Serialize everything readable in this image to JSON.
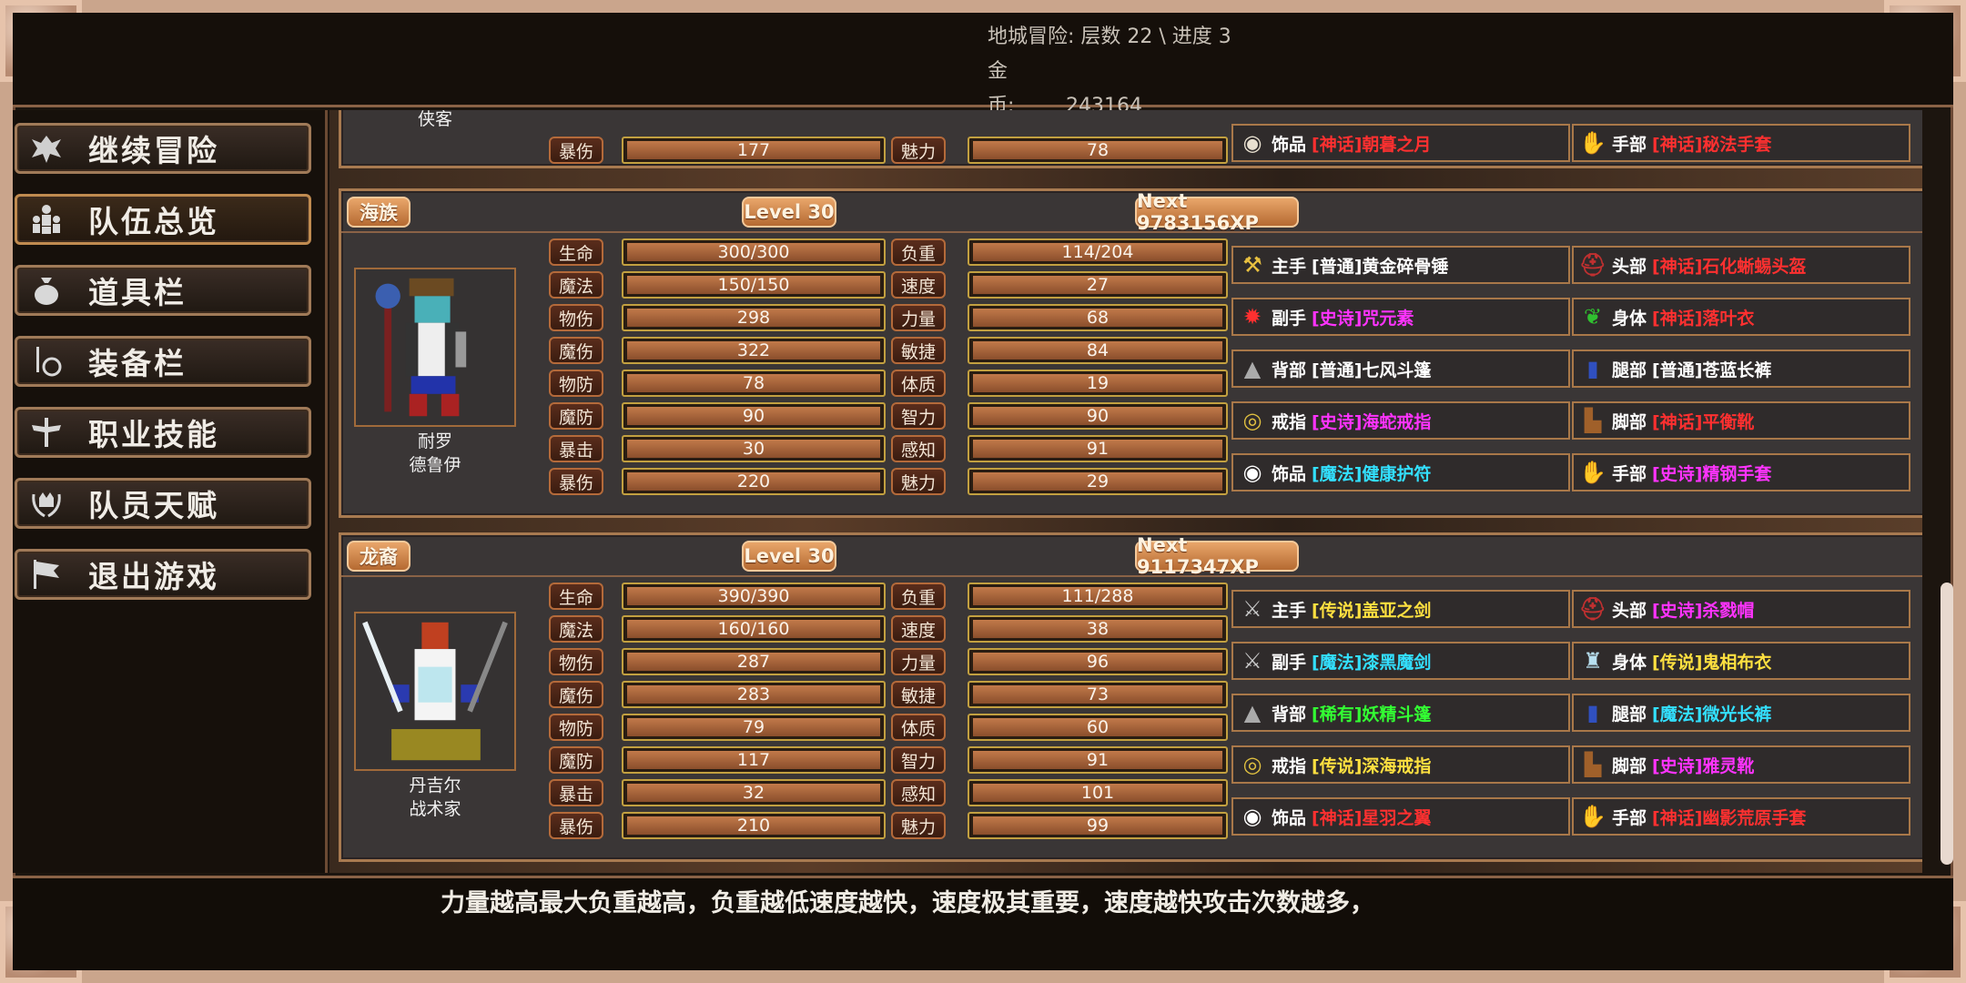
{
  "hud": {
    "dungeon_label": "地城冒险:",
    "dungeon_value": "层数 22 \\ 进度 3",
    "gold_label": "金　　币:",
    "gold_value": "243164"
  },
  "sidebar": {
    "items": [
      {
        "label": "继续冒险",
        "icon": "dragon-icon"
      },
      {
        "label": "队伍总览",
        "icon": "party-icon"
      },
      {
        "label": "道具栏",
        "icon": "bag-icon"
      },
      {
        "label": "装备栏",
        "icon": "sword-shield-icon"
      },
      {
        "label": "职业技能",
        "icon": "winged-sword-icon"
      },
      {
        "label": "队员天赋",
        "icon": "laurel-crown-icon"
      },
      {
        "label": "退出游戏",
        "icon": "flag-icon"
      }
    ]
  },
  "colors": {
    "普通": "#ffffff",
    "魔法": "#33e0ff",
    "稀有": "#33ff33",
    "史诗": "#ff33ff",
    "传说": "#ffe040",
    "神话": "#ff3030"
  },
  "top_partial": {
    "name_line": "侠客",
    "stats": [
      {
        "label": "暴伤",
        "value": "177"
      },
      {
        "label": "魅力",
        "value": "78"
      }
    ],
    "equipment": [
      {
        "slot": "饰品",
        "rarity": "神话",
        "name": "朝暮之月",
        "icon": "ring-amulet-icon"
      },
      {
        "slot": "手部",
        "rarity": "神话",
        "name": "秘法手套",
        "icon": "gauntlet-icon"
      }
    ]
  },
  "members": [
    {
      "race": "海族",
      "level": "Level 30",
      "next": "Next 9783156XP",
      "name_line1": "耐罗",
      "name_line2": "德鲁伊",
      "left_stats": [
        {
          "label": "生命",
          "value": "300/300"
        },
        {
          "label": "魔法",
          "value": "150/150"
        },
        {
          "label": "物伤",
          "value": "298"
        },
        {
          "label": "魔伤",
          "value": "322"
        },
        {
          "label": "物防",
          "value": "78"
        },
        {
          "label": "魔防",
          "value": "90"
        },
        {
          "label": "暴击",
          "value": "30"
        },
        {
          "label": "暴伤",
          "value": "220"
        }
      ],
      "right_stats": [
        {
          "label": "负重",
          "value": "114/204"
        },
        {
          "label": "速度",
          "value": "27"
        },
        {
          "label": "力量",
          "value": "68"
        },
        {
          "label": "敏捷",
          "value": "84"
        },
        {
          "label": "体质",
          "value": "19"
        },
        {
          "label": "智力",
          "value": "90"
        },
        {
          "label": "感知",
          "value": "91"
        },
        {
          "label": "魅力",
          "value": "29"
        }
      ],
      "equipment": [
        {
          "slot": "主手",
          "rarity": "普通",
          "name": "黄金碎骨锤",
          "icon": "mace-icon"
        },
        {
          "slot": "头部",
          "rarity": "神话",
          "name": "石化蜥蜴头盔",
          "icon": "helmet-icon"
        },
        {
          "slot": "副手",
          "rarity": "史诗",
          "name": "咒元素",
          "icon": "spirit-icon"
        },
        {
          "slot": "身体",
          "rarity": "神话",
          "name": "落叶衣",
          "icon": "leaf-armor-icon"
        },
        {
          "slot": "背部",
          "rarity": "普通",
          "name": "七风斗篷",
          "icon": "cloak-icon"
        },
        {
          "slot": "腿部",
          "rarity": "普通",
          "name": "苍蓝长裤",
          "icon": "pants-icon"
        },
        {
          "slot": "戒指",
          "rarity": "史诗",
          "name": "海蛇戒指",
          "icon": "ring-icon"
        },
        {
          "slot": "脚部",
          "rarity": "神话",
          "name": "平衡靴",
          "icon": "boots-icon"
        },
        {
          "slot": "饰品",
          "rarity": "魔法",
          "name": "健康护符",
          "icon": "amulet-icon"
        },
        {
          "slot": "手部",
          "rarity": "史诗",
          "name": "精钢手套",
          "icon": "gauntlet-icon"
        }
      ]
    },
    {
      "race": "龙裔",
      "level": "Level 30",
      "next": "Next 9117347XP",
      "name_line1": "丹吉尔",
      "name_line2": "战术家",
      "left_stats": [
        {
          "label": "生命",
          "value": "390/390"
        },
        {
          "label": "魔法",
          "value": "160/160"
        },
        {
          "label": "物伤",
          "value": "287"
        },
        {
          "label": "魔伤",
          "value": "283"
        },
        {
          "label": "物防",
          "value": "79"
        },
        {
          "label": "魔防",
          "value": "117"
        },
        {
          "label": "暴击",
          "value": "32"
        },
        {
          "label": "暴伤",
          "value": "210"
        }
      ],
      "right_stats": [
        {
          "label": "负重",
          "value": "111/288"
        },
        {
          "label": "速度",
          "value": "38"
        },
        {
          "label": "力量",
          "value": "96"
        },
        {
          "label": "敏捷",
          "value": "73"
        },
        {
          "label": "体质",
          "value": "60"
        },
        {
          "label": "智力",
          "value": "91"
        },
        {
          "label": "感知",
          "value": "101"
        },
        {
          "label": "魅力",
          "value": "99"
        }
      ],
      "equipment": [
        {
          "slot": "主手",
          "rarity": "传说",
          "name": "盖亚之剑",
          "icon": "sword-icon"
        },
        {
          "slot": "头部",
          "rarity": "史诗",
          "name": "杀戮帽",
          "icon": "helmet-icon"
        },
        {
          "slot": "副手",
          "rarity": "魔法",
          "name": "漆黑魔剑",
          "icon": "sword-icon"
        },
        {
          "slot": "身体",
          "rarity": "传说",
          "name": "鬼相布衣",
          "icon": "robe-icon"
        },
        {
          "slot": "背部",
          "rarity": "稀有",
          "name": "妖精斗篷",
          "icon": "cloak-icon"
        },
        {
          "slot": "腿部",
          "rarity": "魔法",
          "name": "微光长裤",
          "icon": "pants-icon"
        },
        {
          "slot": "戒指",
          "rarity": "传说",
          "name": "深海戒指",
          "icon": "ring-icon"
        },
        {
          "slot": "脚部",
          "rarity": "史诗",
          "name": "雅灵靴",
          "icon": "boots-icon"
        },
        {
          "slot": "饰品",
          "rarity": "神话",
          "name": "星羽之翼",
          "icon": "amulet-icon"
        },
        {
          "slot": "手部",
          "rarity": "神话",
          "name": "幽影荒原手套",
          "icon": "gauntlet-icon"
        }
      ]
    }
  ],
  "tip": "力量越高最大负重越高，负重越低速度越快，速度极其重要，速度越快攻击次数越多，"
}
